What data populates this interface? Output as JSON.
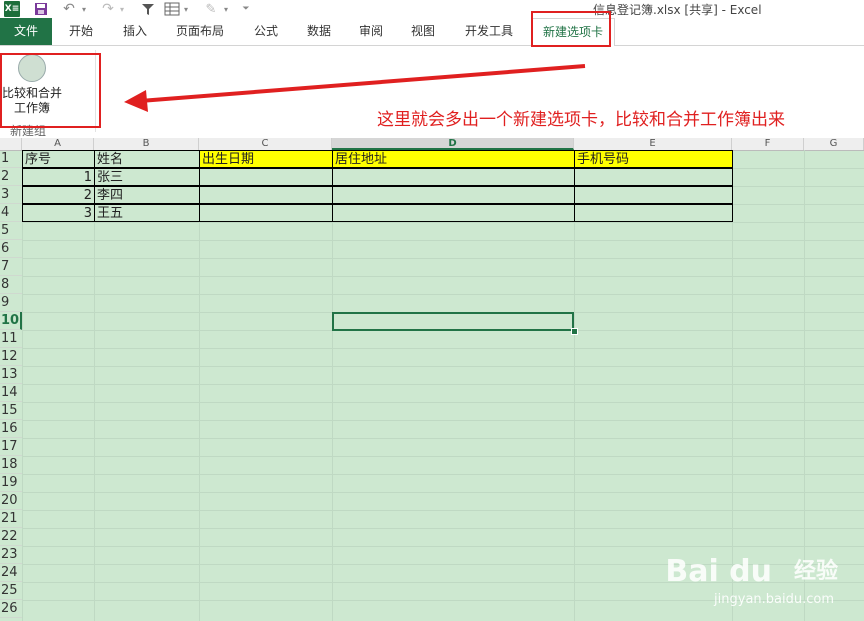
{
  "quick_access": {
    "app_logo_text": "X≡",
    "window_title": "信息登记簿.xlsx  [共享] - Excel"
  },
  "tabs": [
    {
      "id": "file",
      "label": "文件"
    },
    {
      "id": "home",
      "label": "开始"
    },
    {
      "id": "insert",
      "label": "插入"
    },
    {
      "id": "page_layout",
      "label": "页面布局"
    },
    {
      "id": "formulas",
      "label": "公式"
    },
    {
      "id": "data",
      "label": "数据"
    },
    {
      "id": "review",
      "label": "审阅"
    },
    {
      "id": "view",
      "label": "视图"
    },
    {
      "id": "developer",
      "label": "开发工具"
    },
    {
      "id": "new_tab",
      "label": "新建选项卡"
    }
  ],
  "ribbon": {
    "button_label": "比较和合并\n工作簿",
    "group_label": "新建组"
  },
  "annotation": "这里就会多出一个新建选项卡，比较和合并工作簿出来",
  "sheet": {
    "columns": [
      "A",
      "B",
      "C",
      "D",
      "E",
      "F",
      "G"
    ],
    "rows": [
      "1",
      "2",
      "3",
      "4",
      "5",
      "6",
      "7",
      "8",
      "9",
      "10",
      "11",
      "12",
      "13",
      "14",
      "15",
      "16",
      "17",
      "18",
      "19",
      "20",
      "21",
      "22",
      "23",
      "24",
      "25",
      "26"
    ],
    "header": [
      "序号",
      "姓名",
      "出生日期",
      "居住地址",
      "手机号码"
    ],
    "data": [
      [
        "1",
        "张三",
        "",
        "",
        ""
      ],
      [
        "2",
        "李四",
        "",
        "",
        ""
      ],
      [
        "3",
        "王五",
        "",
        "",
        ""
      ]
    ],
    "selected_cell": "D10"
  },
  "colors": {
    "excel_green": "#217346",
    "annotation_red": "#e02020",
    "header_fill": "#ffff00",
    "sheet_background": "#cde8d0"
  },
  "watermark": {
    "brand": "Bai du",
    "cn": "经验",
    "url": "jingyan.baidu.com"
  }
}
